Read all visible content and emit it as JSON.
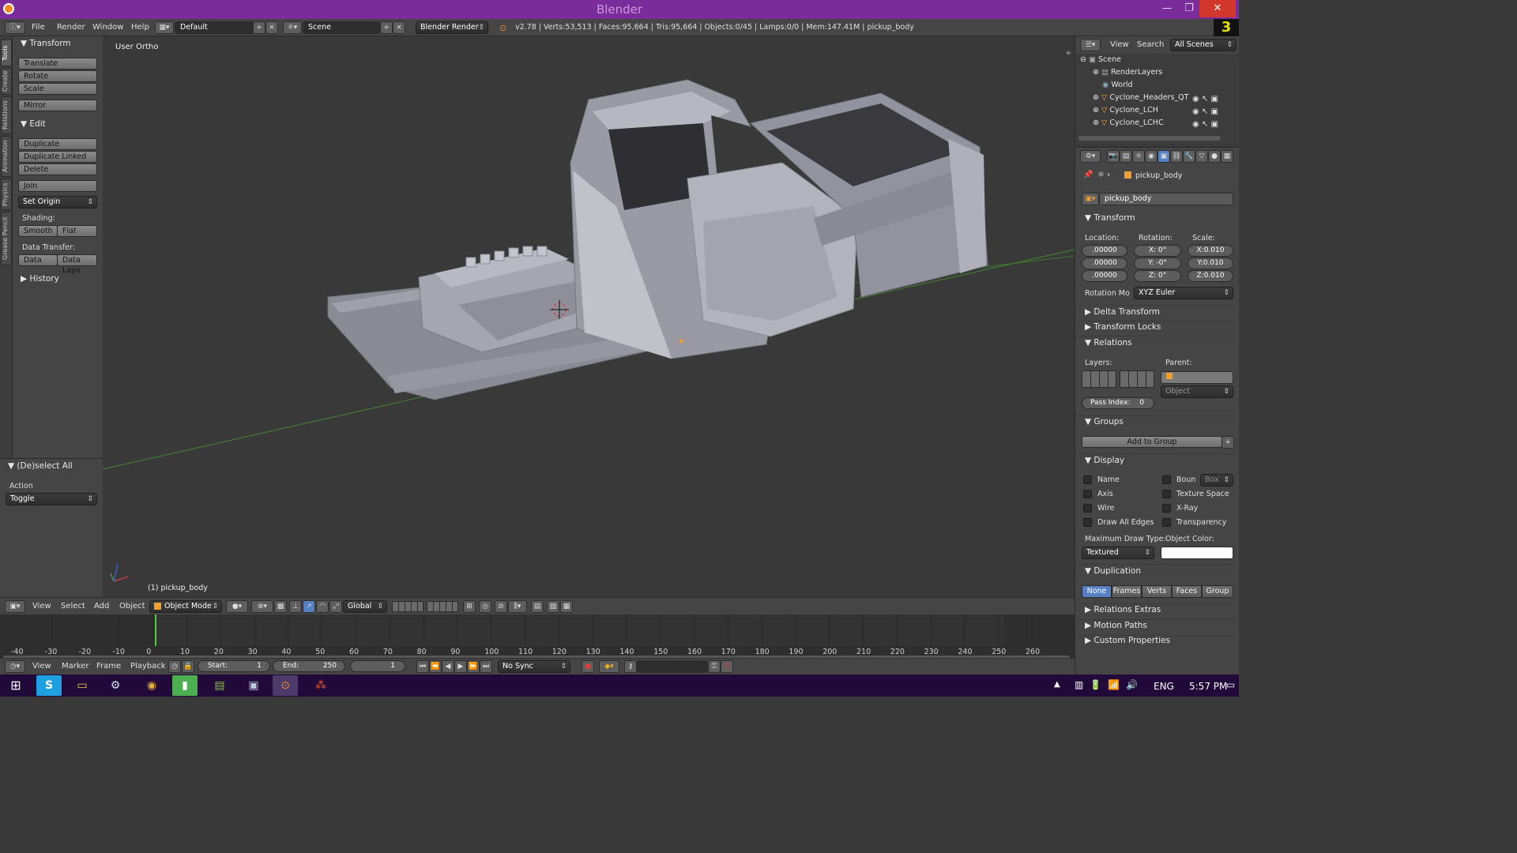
{
  "window": {
    "title": "Blender",
    "minimize": "—",
    "maximize": "❐",
    "close": "✕"
  },
  "info_header": {
    "menus": [
      "File",
      "Render",
      "Window",
      "Help"
    ],
    "layout": "Default",
    "scene": "Scene",
    "engine": "Blender Render",
    "stats": "v2.78 | Verts:53,513 | Faces:95,664 | Tris:95,664 | Objects:0/45 | Lamps:0/0 | Mem:147.41M | pickup_body"
  },
  "tool_tabs": [
    "Tools",
    "Create",
    "Relations",
    "Animation",
    "Physics",
    "Grease Pencil"
  ],
  "toolshelf": {
    "transform_header": "Transform",
    "translate": "Translate",
    "rotate": "Rotate",
    "scale": "Scale",
    "mirror": "Mirror",
    "edit_header": "Edit",
    "duplicate": "Duplicate",
    "duplicate_linked": "Duplicate Linked",
    "delete": "Delete",
    "join": "Join",
    "set_origin": "Set Origin",
    "shading_label": "Shading:",
    "smooth": "Smooth",
    "flat": "Flat",
    "data_transfer_label": "Data Transfer:",
    "data": "Data",
    "data_layout": "Data Layo",
    "history_header": "History"
  },
  "last_operator": {
    "header": "(De)select All",
    "action_label": "Action",
    "action_value": "Toggle"
  },
  "viewport": {
    "view_label": "User Ortho",
    "object_label": "(1) pickup_body"
  },
  "view3d_header": {
    "view": "View",
    "select": "Select",
    "add": "Add",
    "object": "Object",
    "mode": "Object Mode",
    "orientation": "Global"
  },
  "timeline": {
    "ticks": [
      "-40",
      "-30",
      "-20",
      "-10",
      "0",
      "10",
      "20",
      "30",
      "40",
      "50",
      "60",
      "70",
      "80",
      "90",
      "100",
      "110",
      "120",
      "130",
      "140",
      "150",
      "160",
      "170",
      "180",
      "190",
      "200",
      "210",
      "220",
      "230",
      "240",
      "250",
      "260"
    ],
    "current_frame_marker": "0",
    "menus": [
      "View",
      "Marker",
      "Frame",
      "Playback"
    ],
    "start": "Start:",
    "start_value": "1",
    "end": "End:",
    "end_value": "250",
    "current": "1",
    "sync": "No Sync"
  },
  "outliner": {
    "menus": [
      "View",
      "Search"
    ],
    "filter": "All Scenes",
    "rows": [
      {
        "label": "Scene",
        "indent": 0
      },
      {
        "label": "RenderLayers",
        "indent": 1
      },
      {
        "label": "World",
        "indent": 1
      },
      {
        "label": "Cyclone_Headers_QT",
        "indent": 1
      },
      {
        "label": "Cyclone_LCH",
        "indent": 1
      },
      {
        "label": "Cyclone_LCHC",
        "indent": 1
      }
    ]
  },
  "properties": {
    "breadcrumb": "pickup_body",
    "object_name": "pickup_body",
    "transform_header": "Transform",
    "location_label": "Location:",
    "rotation_label": "Rotation:",
    "scale_label": "Scale:",
    "location": [
      ".00000",
      ".00000",
      ".00000"
    ],
    "rotation": [
      "X:",
      "0°",
      "Y:",
      "-0°",
      "Z:",
      "0°"
    ],
    "scale": [
      "X:0.010",
      "Y:0.010",
      "Z:0.010"
    ],
    "rotation_mode_label": "Rotation Mo",
    "rotation_mode": "XYZ Euler",
    "delta_transform": "Delta Transform",
    "transform_locks": "Transform Locks",
    "relations": "Relations",
    "layers_label": "Layers:",
    "parent_label": "Parent:",
    "parent_type": "Object",
    "pass_index_label": "Pass Index:",
    "pass_index": "0",
    "groups": "Groups",
    "add_to_group": "Add to Group",
    "display": "Display",
    "display_checks": [
      "Name",
      "Axis",
      "Wire",
      "Draw All Edges"
    ],
    "display_checks_right": [
      "Boun",
      "Texture Space",
      "X-Ray",
      "Transparency"
    ],
    "bounds_type": "Box",
    "max_draw_type_label": "Maximum Draw Type:",
    "object_color_label": "Object Color:",
    "max_draw_type": "Textured",
    "duplication": "Duplication",
    "dup_options": [
      "None",
      "Frames",
      "Verts",
      "Faces",
      "Group"
    ],
    "relations_extras": "Relations Extras",
    "motion_paths": "Motion Paths",
    "custom_properties": "Custom Properties"
  },
  "taskbar": {
    "language": "ENG",
    "time": "5:57 PM"
  },
  "colors": {
    "title_bar": "#7a2d9a",
    "taskbar": "#21093a",
    "selected_blue": "#5680c2",
    "grid_green": "#3f7a2e",
    "mesh_grey": "#9d9da8"
  }
}
